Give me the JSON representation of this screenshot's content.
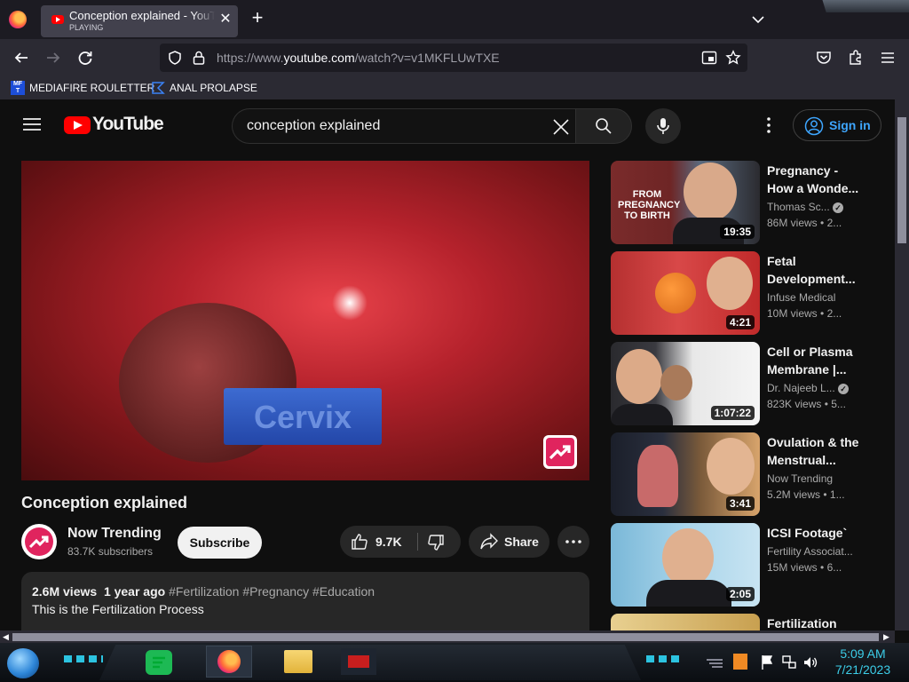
{
  "browser": {
    "tab": {
      "title": "Conception explained - YouTube",
      "status": "PLAYING"
    },
    "url": {
      "prefix": "https://www.",
      "domain": "youtube.com",
      "path": "/watch?v=v1MKFLUwTXE"
    },
    "bookmarks": [
      {
        "label": "MEDIAFIRE ROULETTER",
        "icon": "mediafire-icon"
      },
      {
        "label": "ANAL PROLAPSE",
        "icon": "bookmark-icon"
      }
    ]
  },
  "youtube": {
    "logo_text": "YouTube",
    "search": {
      "value": "conception explained"
    },
    "sign_in_label": "Sign in",
    "video": {
      "overlay_text": "Cervix",
      "title": "Conception explained",
      "channel": {
        "name": "Now Trending",
        "subscribers": "83.7K subscribers"
      },
      "subscribe_label": "Subscribe",
      "likes": "9.7K",
      "share_label": "Share",
      "description": {
        "views": "2.6M views",
        "age": "1 year ago",
        "hashtags": "#Fertilization #Pregnancy #Education",
        "text": "This is the Fertilization Process"
      }
    },
    "recommendations": [
      {
        "title": "Pregnancy - How a Wonde...",
        "channel": "Thomas Sc...",
        "verified": true,
        "views": "86M views",
        "age": "2...",
        "duration": "19:35",
        "thumb_text": "FROM PREGNANCY TO BIRTH"
      },
      {
        "title": "Fetal Development...",
        "channel": "Infuse Medical",
        "verified": false,
        "views": "10M views",
        "age": "2...",
        "duration": "4:21"
      },
      {
        "title": "Cell or Plasma Membrane |...",
        "channel": "Dr. Najeeb L...",
        "verified": true,
        "views": "823K views",
        "age": "5...",
        "duration": "1:07:22"
      },
      {
        "title": "Ovulation & the Menstrual...",
        "channel": "Now Trending",
        "verified": false,
        "views": "5.2M views",
        "age": "1...",
        "duration": "3:41"
      },
      {
        "title": "ICSI Footage`",
        "channel": "Fertility Associat...",
        "verified": false,
        "views": "15M views",
        "age": "6...",
        "duration": "2:05"
      },
      {
        "title": "Fertilization",
        "channel": "",
        "verified": false,
        "views": "",
        "age": "",
        "duration": ""
      }
    ]
  },
  "taskbar": {
    "time": "5:09 AM",
    "date": "7/21/2023"
  },
  "colors": {
    "youtube_red": "#ff0000",
    "brand_channel": "#e0245e",
    "sign_in_blue": "#3ea6ff",
    "clock_cyan": "#3ccde8"
  }
}
